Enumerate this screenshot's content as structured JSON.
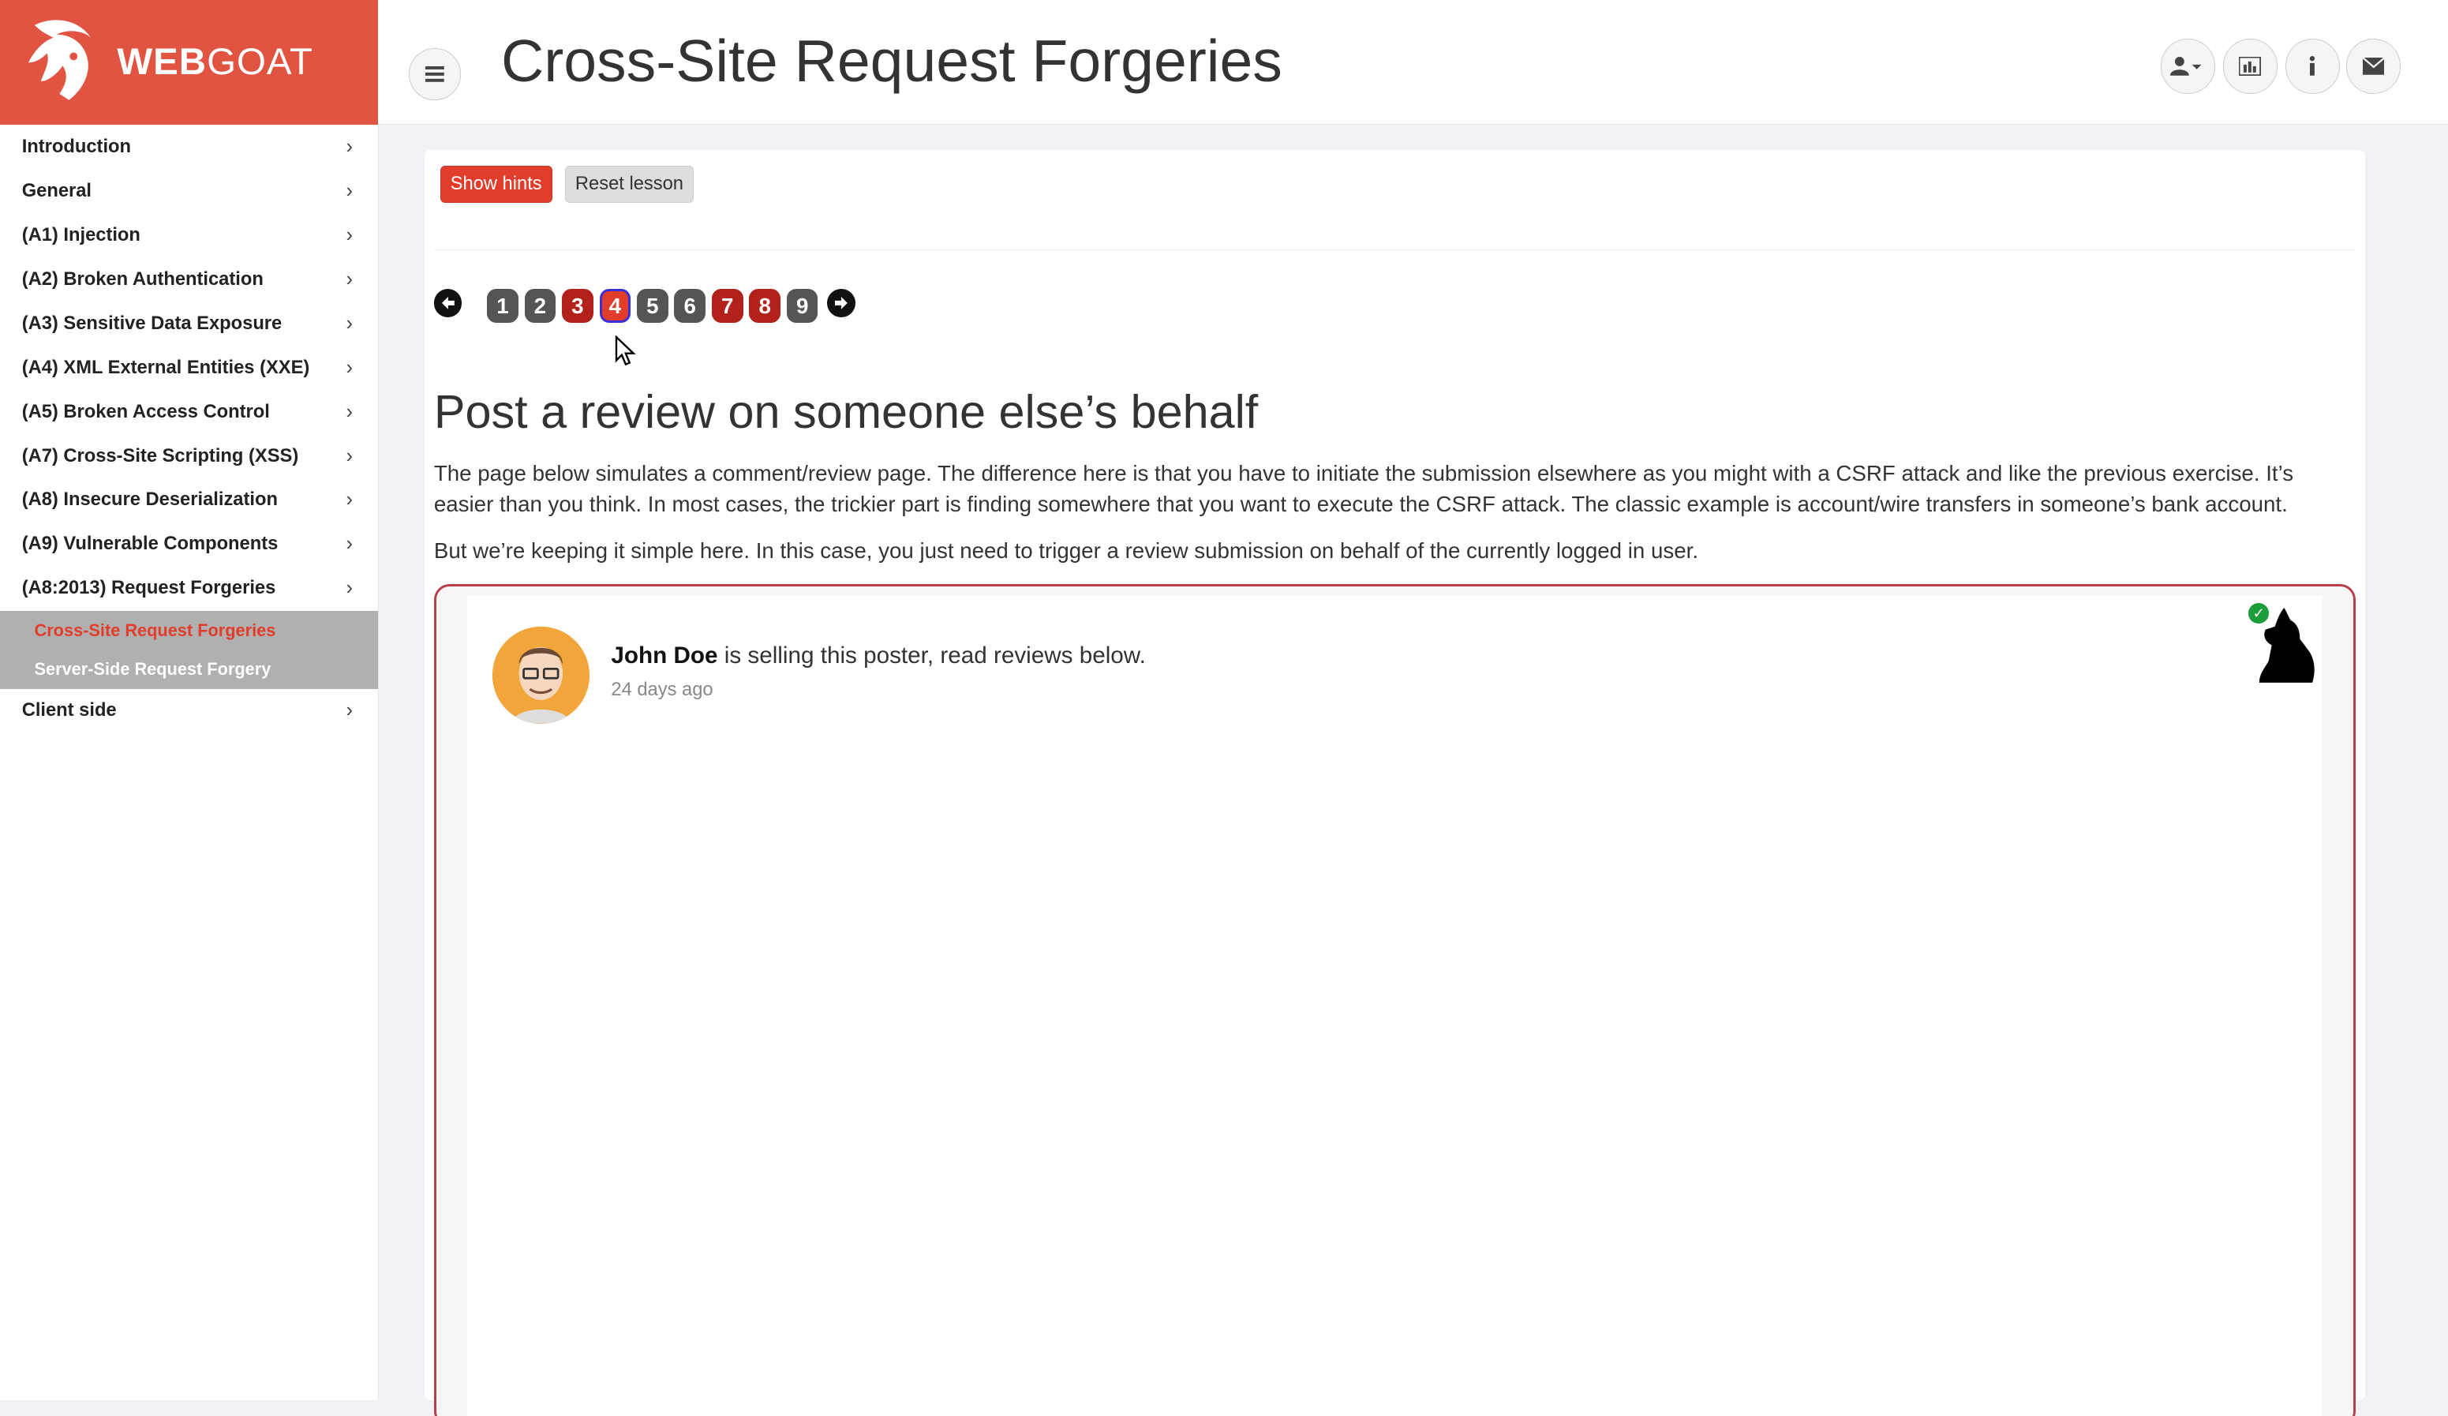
{
  "logo": {
    "web": "WEB",
    "goat": "GOAT"
  },
  "page_title": "Cross-Site Request Forgeries",
  "sidebar": {
    "items": [
      {
        "label": "Introduction"
      },
      {
        "label": "General"
      },
      {
        "label": "(A1) Injection"
      },
      {
        "label": "(A2) Broken Authentication"
      },
      {
        "label": "(A3) Sensitive Data Exposure"
      },
      {
        "label": "(A4) XML External Entities (XXE)"
      },
      {
        "label": "(A5) Broken Access Control"
      },
      {
        "label": "(A7) Cross-Site Scripting (XSS)"
      },
      {
        "label": "(A8) Insecure Deserialization"
      },
      {
        "label": "(A9) Vulnerable Components"
      },
      {
        "label": "(A8:2013) Request Forgeries"
      }
    ],
    "subitems": [
      {
        "label": "Cross-Site Request Forgeries",
        "active": true
      },
      {
        "label": "Server-Side Request Forgery",
        "active": false
      }
    ],
    "after": {
      "label": "Client side"
    },
    "chevron": "›"
  },
  "header_buttons": [
    "user-icon",
    "chart-icon",
    "info-icon",
    "envelope-icon"
  ],
  "buttons": {
    "show_hints": "Show hints",
    "reset_lesson": "Reset lesson"
  },
  "pagination": {
    "pages": [
      "1",
      "2",
      "3",
      "4",
      "5",
      "6",
      "7",
      "8",
      "9"
    ],
    "current": "4",
    "completed": [
      "3",
      "4",
      "7",
      "8"
    ]
  },
  "lesson": {
    "title": "Post a review on someone else’s behalf",
    "para1": "The page below simulates a comment/review page. The difference here is that you have to initiate the submission elsewhere as you might with a CSRF attack and like the previous exercise. It’s easier than you think. In most cases, the trickier part is finding somewhere that you want to execute the CSRF attack. The classic example is account/wire transfers in someone’s bank account.",
    "para2": "But we’re keeping it simple here. In this case, you just need to trigger a review submission on behalf of the currently logged in user."
  },
  "review": {
    "seller_name": "John Doe",
    "seller_text": " is selling this poster, read reviews below.",
    "time_ago": "24 days ago"
  },
  "colors": {
    "brand": "#e25442",
    "accent_red": "#b3211b",
    "active_link": "#e23c2a",
    "success": "#1b9e3a"
  }
}
